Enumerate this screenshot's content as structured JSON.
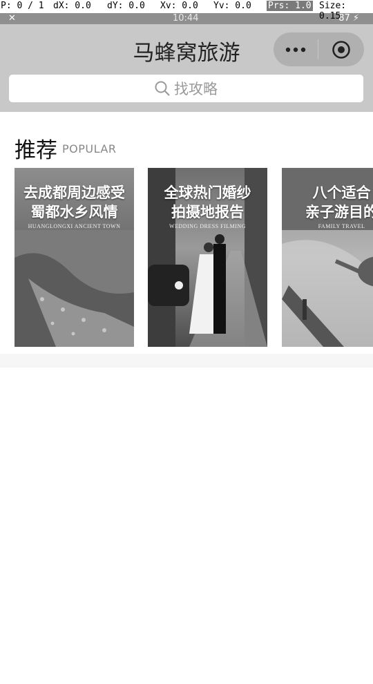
{
  "debug": {
    "p": "P: 0 / 1",
    "dx": "dX: 0.0",
    "dy": "dY: 0.0",
    "xv": "Xv: 0.0",
    "yv": "Yv: 0.0",
    "prs": "Prs: 1.0",
    "size": "Size: 0.15"
  },
  "status": {
    "time": "10:44",
    "battery": "87"
  },
  "header": {
    "title": "马蜂窝旅游"
  },
  "search": {
    "placeholder": "找攻略"
  },
  "section": {
    "title": "推荐",
    "subtitle": "POPULAR"
  },
  "cards": [
    {
      "title_line1": "去成都周边感受",
      "title_line2": "蜀都水乡风情",
      "subtitle": "HUANGLONGXI ANCIENT TOWN"
    },
    {
      "title_line1": "全球热门婚纱",
      "title_line2": "拍摄地报告",
      "subtitle": "WEDDING DRESS FILMING"
    },
    {
      "title_line1": "八个适合",
      "title_line2": "亲子游目的",
      "subtitle": "FAMILY TRAVEL"
    }
  ]
}
